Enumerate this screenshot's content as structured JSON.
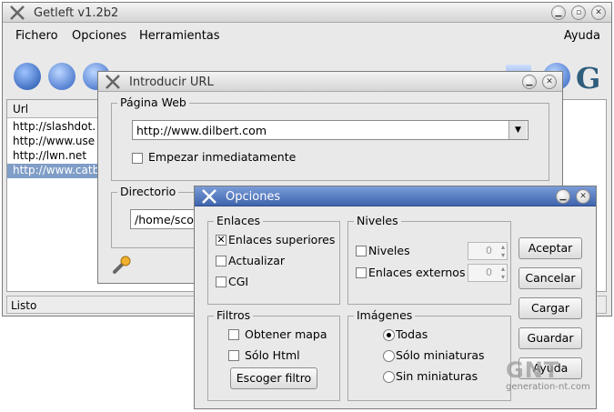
{
  "main": {
    "title": "Getleft v1.2b2",
    "menu": [
      "Fichero",
      "Opciones",
      "Herramientas",
      "Ayuda"
    ],
    "column_header": "Url",
    "rows": [
      "http://slashdot.",
      "http://www.use",
      "http://lwn.net",
      "http://www.catb"
    ],
    "status": "Listo"
  },
  "url_dialog": {
    "title": "Introducir URL",
    "web_group": "Página Web",
    "url_value": "http://www.dilbert.com",
    "start_now": "Empezar inmediatamente",
    "dir_group": "Directorio",
    "dir_value": "/home/sco"
  },
  "options": {
    "title": "Opciones",
    "links_group": "Enlaces",
    "links": [
      {
        "label": "Enlaces superiores",
        "checked": true
      },
      {
        "label": "Actualizar",
        "checked": false
      },
      {
        "label": "CGI",
        "checked": false
      }
    ],
    "levels_group": "Niveles",
    "levels": [
      {
        "label": "Niveles",
        "value": "0"
      },
      {
        "label": "Enlaces externos",
        "value": "0"
      }
    ],
    "filters_group": "Filtros",
    "filters": [
      "Obtener mapa",
      "Sólo Html"
    ],
    "filter_button": "Escoger filtro",
    "images_group": "Imágenes",
    "images": [
      {
        "label": "Todas",
        "selected": true
      },
      {
        "label": "Sólo miniaturas",
        "selected": false
      },
      {
        "label": "Sin miniaturas",
        "selected": false
      }
    ],
    "buttons": [
      "Aceptar",
      "Cancelar",
      "Cargar",
      "Guardar",
      "Ayuda"
    ]
  },
  "watermark": {
    "logo": "GNT",
    "site": "generation-nt.com"
  },
  "colors": {
    "selection": "#7f9dc6",
    "active_title": "#3f64ad",
    "window_bg": "#e9e9e9"
  }
}
